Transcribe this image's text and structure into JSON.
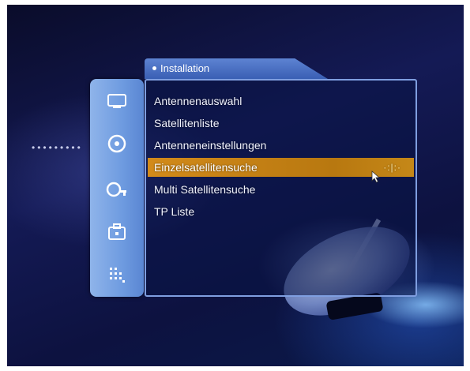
{
  "tab": {
    "title": "Installation"
  },
  "menu": {
    "items": [
      {
        "label": "Antennenauswahl"
      },
      {
        "label": "Satellitenliste"
      },
      {
        "label": "Antenneneinstellungen"
      },
      {
        "label": "Einzelsatellitensuche",
        "selected": true
      },
      {
        "label": "Multi Satellitensuche"
      },
      {
        "label": "TP Liste"
      }
    ]
  },
  "sidebar": {
    "icons": [
      "tv-icon",
      "disc-icon",
      "key-icon",
      "case-icon",
      "grid-icon"
    ],
    "active_index": 1
  },
  "colors": {
    "highlight": "#c58818",
    "panel_border": "#7f9ee0",
    "sidebar": "#6e9be0"
  }
}
